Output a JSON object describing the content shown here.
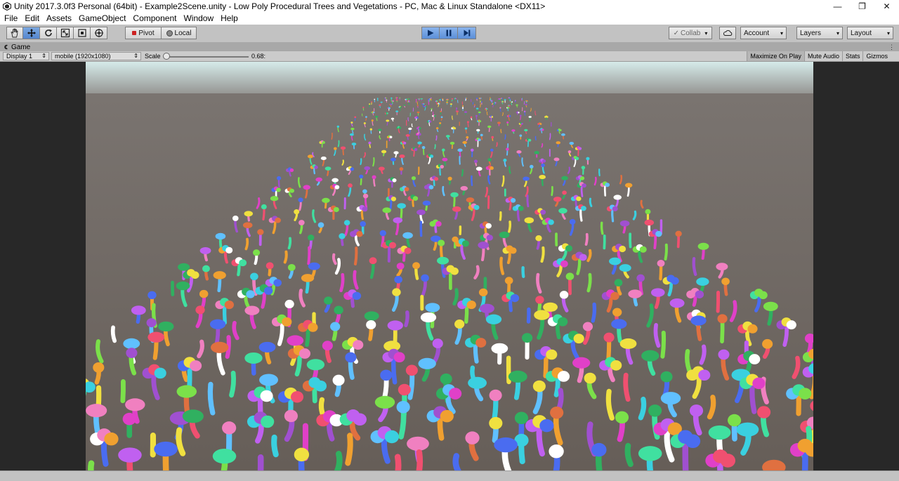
{
  "window": {
    "title": "Unity 2017.3.0f3 Personal (64bit) - Example2Scene.unity - Low Poly Procedural Trees and Vegetations - PC, Mac & Linux Standalone <DX11>",
    "minimize": "—",
    "restore": "❐",
    "close": "✕"
  },
  "menu": [
    "File",
    "Edit",
    "Assets",
    "GameObject",
    "Component",
    "Window",
    "Help"
  ],
  "toolbar": {
    "pivot_label": "Pivot",
    "local_label": "Local",
    "collab_label": "Collab",
    "account_label": "Account",
    "layers_label": "Layers",
    "layout_label": "Layout"
  },
  "game_tab": {
    "label": "Game",
    "display": "Display 1",
    "resolution": "mobile (1920x1080)",
    "scale_label": "Scale",
    "scale_value": "0.68:",
    "scale_level": 0.0,
    "toggles": [
      "Maximize On Play",
      "Mute Audio",
      "Stats",
      "Gizmos"
    ],
    "active_toggle": "Maximize On Play"
  },
  "colors": {
    "play_accent": "#5b8ed8",
    "ground": "#6e6660",
    "sky": "#cfe5e4",
    "viewport_border": "#282828"
  }
}
